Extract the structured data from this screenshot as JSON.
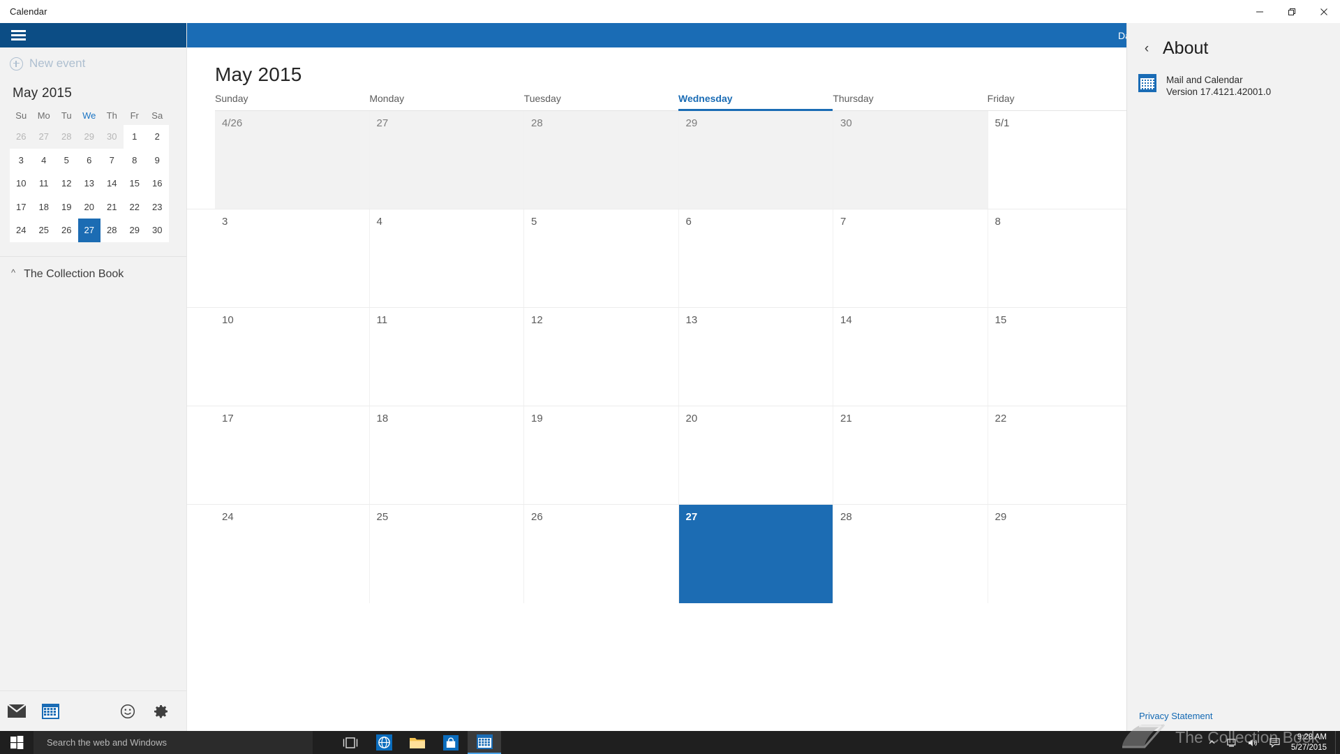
{
  "window": {
    "title": "Calendar",
    "minimize_label": "Minimize",
    "maximize_label": "Maximize",
    "close_label": "Close"
  },
  "sidebar": {
    "menu_icon": "hamburger-icon",
    "new_event_label": "New event",
    "mini_calendar": {
      "month_label": "May 2015",
      "weekday_headers": [
        "Su",
        "Mo",
        "Tu",
        "We",
        "Th",
        "Fr",
        "Sa"
      ],
      "today_column_index": 3,
      "weeks": [
        [
          {
            "d": "26",
            "other": true,
            "white": false,
            "sel": false
          },
          {
            "d": "27",
            "other": true,
            "white": false,
            "sel": false
          },
          {
            "d": "28",
            "other": true,
            "white": false,
            "sel": false
          },
          {
            "d": "29",
            "other": true,
            "white": false,
            "sel": false
          },
          {
            "d": "30",
            "other": true,
            "white": false,
            "sel": false
          },
          {
            "d": "1",
            "other": false,
            "white": true,
            "sel": false
          },
          {
            "d": "2",
            "other": false,
            "white": true,
            "sel": false
          }
        ],
        [
          {
            "d": "3",
            "other": false,
            "white": true,
            "sel": false
          },
          {
            "d": "4",
            "other": false,
            "white": true,
            "sel": false
          },
          {
            "d": "5",
            "other": false,
            "white": true,
            "sel": false
          },
          {
            "d": "6",
            "other": false,
            "white": true,
            "sel": false
          },
          {
            "d": "7",
            "other": false,
            "white": true,
            "sel": false
          },
          {
            "d": "8",
            "other": false,
            "white": true,
            "sel": false
          },
          {
            "d": "9",
            "other": false,
            "white": true,
            "sel": false
          }
        ],
        [
          {
            "d": "10",
            "other": false,
            "white": true,
            "sel": false
          },
          {
            "d": "11",
            "other": false,
            "white": true,
            "sel": false
          },
          {
            "d": "12",
            "other": false,
            "white": true,
            "sel": false
          },
          {
            "d": "13",
            "other": false,
            "white": true,
            "sel": false
          },
          {
            "d": "14",
            "other": false,
            "white": true,
            "sel": false
          },
          {
            "d": "15",
            "other": false,
            "white": true,
            "sel": false
          },
          {
            "d": "16",
            "other": false,
            "white": true,
            "sel": false
          }
        ],
        [
          {
            "d": "17",
            "other": false,
            "white": true,
            "sel": false
          },
          {
            "d": "18",
            "other": false,
            "white": true,
            "sel": false
          },
          {
            "d": "19",
            "other": false,
            "white": true,
            "sel": false
          },
          {
            "d": "20",
            "other": false,
            "white": true,
            "sel": false
          },
          {
            "d": "21",
            "other": false,
            "white": true,
            "sel": false
          },
          {
            "d": "22",
            "other": false,
            "white": true,
            "sel": false
          },
          {
            "d": "23",
            "other": false,
            "white": true,
            "sel": false
          }
        ],
        [
          {
            "d": "24",
            "other": false,
            "white": true,
            "sel": false
          },
          {
            "d": "25",
            "other": false,
            "white": true,
            "sel": false
          },
          {
            "d": "26",
            "other": false,
            "white": true,
            "sel": false
          },
          {
            "d": "27",
            "other": false,
            "white": false,
            "sel": true
          },
          {
            "d": "28",
            "other": false,
            "white": true,
            "sel": false
          },
          {
            "d": "29",
            "other": false,
            "white": true,
            "sel": false
          },
          {
            "d": "30",
            "other": false,
            "white": true,
            "sel": false
          }
        ]
      ]
    },
    "collection": {
      "chevron": "chevron-up-icon",
      "label": "The Collection Book"
    },
    "bottom_icons": [
      {
        "name": "mail-icon",
        "label": "Mail"
      },
      {
        "name": "calendar-icon",
        "label": "Calendar"
      },
      {
        "name": "feedback-smiley-icon",
        "label": "Feedback"
      },
      {
        "name": "settings-gear-icon",
        "label": "Settings"
      }
    ]
  },
  "main": {
    "view_button_label": "Day",
    "month_title": "May 2015",
    "weekday_headers": [
      "Sunday",
      "Monday",
      "Tuesday",
      "Wednesday",
      "Thursday",
      "Friday"
    ],
    "today_header_index": 3,
    "weeks": [
      [
        {
          "d": "4/26",
          "dim": true,
          "sel": false
        },
        {
          "d": "27",
          "dim": true,
          "sel": false
        },
        {
          "d": "28",
          "dim": true,
          "sel": false
        },
        {
          "d": "29",
          "dim": true,
          "sel": false
        },
        {
          "d": "30",
          "dim": true,
          "sel": false
        },
        {
          "d": "5/1",
          "dim": false,
          "sel": false
        }
      ],
      [
        {
          "d": "3",
          "dim": false,
          "sel": false
        },
        {
          "d": "4",
          "dim": false,
          "sel": false
        },
        {
          "d": "5",
          "dim": false,
          "sel": false
        },
        {
          "d": "6",
          "dim": false,
          "sel": false
        },
        {
          "d": "7",
          "dim": false,
          "sel": false
        },
        {
          "d": "8",
          "dim": false,
          "sel": false
        }
      ],
      [
        {
          "d": "10",
          "dim": false,
          "sel": false
        },
        {
          "d": "11",
          "dim": false,
          "sel": false
        },
        {
          "d": "12",
          "dim": false,
          "sel": false
        },
        {
          "d": "13",
          "dim": false,
          "sel": false
        },
        {
          "d": "14",
          "dim": false,
          "sel": false
        },
        {
          "d": "15",
          "dim": false,
          "sel": false
        }
      ],
      [
        {
          "d": "17",
          "dim": false,
          "sel": false
        },
        {
          "d": "18",
          "dim": false,
          "sel": false
        },
        {
          "d": "19",
          "dim": false,
          "sel": false
        },
        {
          "d": "20",
          "dim": false,
          "sel": false
        },
        {
          "d": "21",
          "dim": false,
          "sel": false
        },
        {
          "d": "22",
          "dim": false,
          "sel": false
        }
      ],
      [
        {
          "d": "24",
          "dim": false,
          "sel": false
        },
        {
          "d": "25",
          "dim": false,
          "sel": false
        },
        {
          "d": "26",
          "dim": false,
          "sel": false
        },
        {
          "d": "27",
          "dim": false,
          "sel": true
        },
        {
          "d": "28",
          "dim": false,
          "sel": false
        },
        {
          "d": "29",
          "dim": false,
          "sel": false
        }
      ]
    ]
  },
  "about": {
    "back_icon": "chevron-left-icon",
    "title": "About",
    "app_icon": "calendar-app-icon",
    "app_name": "Mail and Calendar",
    "app_version": "Version 17.4121.42001.0",
    "privacy_link": "Privacy Statement"
  },
  "taskbar": {
    "start_icon": "windows-start-icon",
    "search_placeholder": "Search the web and Windows",
    "icons": [
      {
        "name": "task-view-icon",
        "label": "Task View"
      },
      {
        "name": "edge-browser-icon",
        "label": "Microsoft Edge"
      },
      {
        "name": "file-explorer-icon",
        "label": "File Explorer"
      },
      {
        "name": "store-icon",
        "label": "Store"
      },
      {
        "name": "calendar-taskbar-icon",
        "label": "Calendar",
        "active": true
      }
    ],
    "tray": [
      {
        "name": "show-hidden-icons-icon"
      },
      {
        "name": "network-icon"
      },
      {
        "name": "volume-icon"
      },
      {
        "name": "action-center-icon"
      }
    ],
    "clock_time": "9:28 AM",
    "clock_date": "5/27/2015"
  },
  "watermark": {
    "icon": "book-icon",
    "text": "The Collection Book"
  },
  "colors": {
    "accent": "#1a6cb5",
    "accent_dark": "#0c4d85",
    "selected": "#1c6cb3",
    "sidebar_bg": "#f2f2f2",
    "link": "#1268b3"
  }
}
